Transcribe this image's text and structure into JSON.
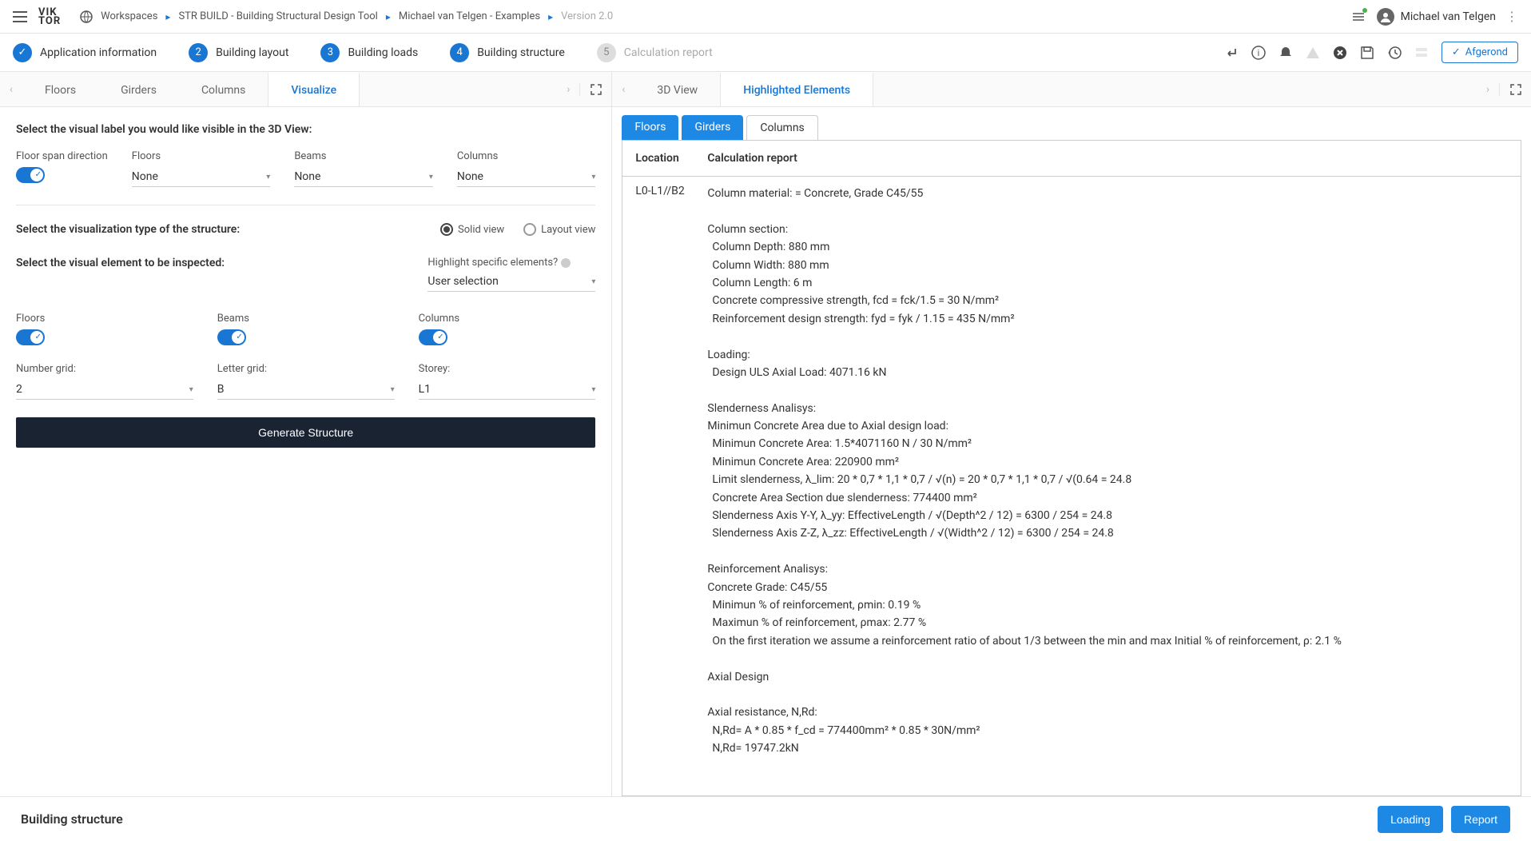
{
  "header": {
    "breadcrumb": {
      "workspaces": "Workspaces",
      "project": "STR BUILD - Building Structural Design Tool",
      "user_folder": "Michael van Telgen - Examples",
      "version": "Version 2.0"
    },
    "username": "Michael van Telgen"
  },
  "stepper": {
    "steps": [
      {
        "num": "✓",
        "label": "Application information"
      },
      {
        "num": "2",
        "label": "Building layout"
      },
      {
        "num": "3",
        "label": "Building loads"
      },
      {
        "num": "4",
        "label": "Building structure"
      },
      {
        "num": "5",
        "label": "Calculation report"
      }
    ],
    "afgerond": "Afgerond"
  },
  "left": {
    "tabs": [
      "Floors",
      "Girders",
      "Columns",
      "Visualize"
    ],
    "active_tab": "Visualize",
    "section1_title": "Select the visual label you would like visible in the 3D View:",
    "floor_span_label": "Floor span direction",
    "floors_label": "Floors",
    "floors_value": "None",
    "beams_label": "Beams",
    "beams_value": "None",
    "columns_label": "Columns",
    "columns_value": "None",
    "section2_title": "Select the visualization type of the structure:",
    "solid_view": "Solid view",
    "layout_view": "Layout view",
    "section3_title": "Select the visual element to be inspected:",
    "highlight_label": "Highlight specific elements?",
    "highlight_value": "User selection",
    "floors_toggle_label": "Floors",
    "beams_toggle_label": "Beams",
    "columns_toggle_label": "Columns",
    "number_grid_label": "Number grid:",
    "number_grid_value": "2",
    "letter_grid_label": "Letter grid:",
    "letter_grid_value": "B",
    "storey_label": "Storey:",
    "storey_value": "L1",
    "generate_btn": "Generate Structure"
  },
  "right": {
    "tabs": [
      "3D View",
      "Highlighted Elements"
    ],
    "active_tab": "Highlighted Elements",
    "subtabs": [
      "Floors",
      "Girders",
      "Columns"
    ],
    "table_header_location": "Location",
    "table_header_report": "Calculation report",
    "location_value": "L0-L1//B2",
    "report": {
      "material": "Column material:  = Concrete, Grade C45/55",
      "section_title": "Column section:",
      "depth": " Column Depth:      880 mm",
      "width": " Column Width:      880 mm",
      "length": " Column Length:       6 m",
      "fcd": " Concrete compressive strength, fcd = fck/1.5 = 30 N/mm²",
      "fyd": " Reinforcement design strength: fyd = fyk / 1.15 = 435 N/mm²",
      "loading_title": "Loading:",
      "uls": " Design ULS Axial Load: 4071.16 kN",
      "slender_title": "Slenderness Analisys:",
      "min_area_title": "Minimun Concrete Area due to Axial design load:",
      "min_area1": " Minimun Concrete Area:      1.5*4071160 N / 30 N/mm²",
      "min_area2": " Minimun Concrete Area:      220900 mm²",
      "limit_slender": " Limit slenderness, λ_lim: 20 * 0,7 * 1,1 * 0,7 / √(n) =    20 * 0,7 * 1,1 * 0,7 / √(0.64 = 24.8",
      "area_section": " Concrete Area Section due slenderness:    774400 mm²",
      "slender_yy": " Slenderness Axis Y-Y, λ_yy: EffectiveLength / √(Depth^2 / 12) =    6300 / 254 = 24.8",
      "slender_zz": " Slenderness Axis Z-Z, λ_zz: EffectiveLength / √(Width^2 / 12) =    6300 / 254 = 24.8",
      "reinf_title": "Reinforcement Analisys:",
      "grade": "Concrete Grade: C45/55",
      "pmin": " Minimun % of reinforcement, ρmin:      0.19 %",
      "pmax": " Maximun % of reinforcement, ρmax:      2.77 %",
      "iter": " On the first iteration we assume a reinforcement ratio of about 1/3 between the min and max Initial % of reinforcement, ρ:      2.1 %",
      "axial_title": "Axial Design",
      "axial_res_title": "Axial resistance, N,Rd:",
      "nrd1": " N,Rd= A * 0.85 * f_cd = 774400mm² * 0.85 * 30N/mm²",
      "nrd2": " N,Rd= 19747.2kN"
    }
  },
  "bottom": {
    "title": "Building structure",
    "loading_btn": "Loading",
    "report_btn": "Report"
  }
}
